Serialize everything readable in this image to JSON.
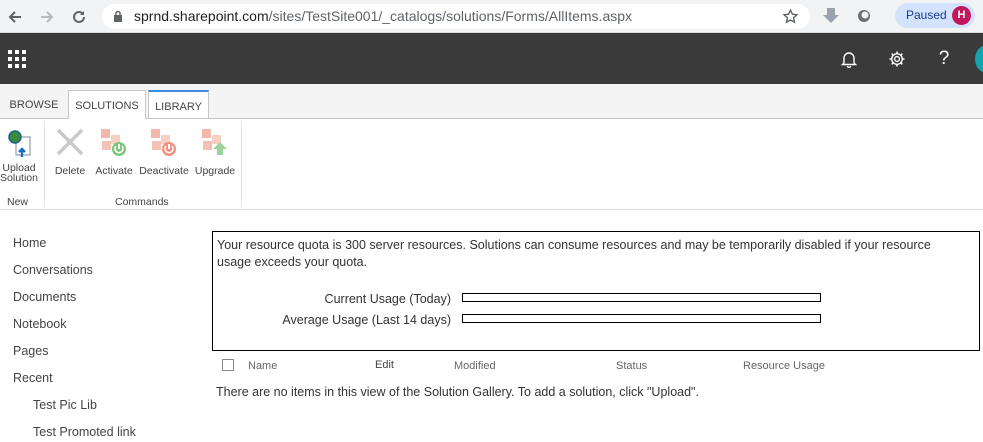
{
  "browser": {
    "url_host": "sprnd.sharepoint.com",
    "url_path": "/sites/TestSite001/_catalogs/solutions/Forms/AllItems.aspx",
    "profile_status": "Paused",
    "profile_initial": "H",
    "icons": [
      "back-icon",
      "forward-icon",
      "reload-icon",
      "lock-icon",
      "star-icon",
      "download-extension-icon",
      "extension-icon"
    ]
  },
  "suite_bar": {
    "icons": [
      "app-launcher-icon",
      "notification-bell-icon",
      "settings-gear-icon",
      "help-icon"
    ],
    "help_glyph": "?"
  },
  "ribbon": {
    "tabs": [
      "BROWSE",
      "SOLUTIONS",
      "LIBRARY"
    ],
    "active_tab": "SOLUTIONS",
    "groups": [
      {
        "label": "New",
        "buttons": [
          {
            "label_line1": "Upload",
            "label_line2": "Solution",
            "icon": "upload-solution-icon"
          }
        ]
      },
      {
        "label": "Commands",
        "buttons": [
          {
            "label": "Delete",
            "icon": "delete-icon"
          },
          {
            "label": "Activate",
            "icon": "activate-icon"
          },
          {
            "label": "Deactivate",
            "icon": "deactivate-icon"
          },
          {
            "label": "Upgrade",
            "icon": "upgrade-icon"
          }
        ]
      }
    ]
  },
  "left_nav": {
    "items": [
      "Home",
      "Conversations",
      "Documents",
      "Notebook",
      "Pages",
      "Recent"
    ],
    "sub_items": [
      "Test Pic Lib",
      "Test Promoted link"
    ]
  },
  "quota": {
    "message": "Your resource quota is 300 server resources. Solutions can consume resources and may be temporarily disabled if your resource usage exceeds your quota.",
    "current_label": "Current Usage (Today)",
    "average_label": "Average Usage (Last 14 days)",
    "current_fraction": 0,
    "average_fraction": 0
  },
  "list": {
    "columns": [
      "Name",
      "Edit",
      "Modified",
      "Status",
      "Resource Usage"
    ],
    "empty_message": "There are no items in this view of the Solution Gallery. To add a solution, click \"Upload\"."
  },
  "colors": {
    "suite_bar": "#3a3a3a",
    "library_tab_accent": "#3e8ddd",
    "avatar": "#c2185b",
    "paused_pill": "#d3e3fd"
  }
}
